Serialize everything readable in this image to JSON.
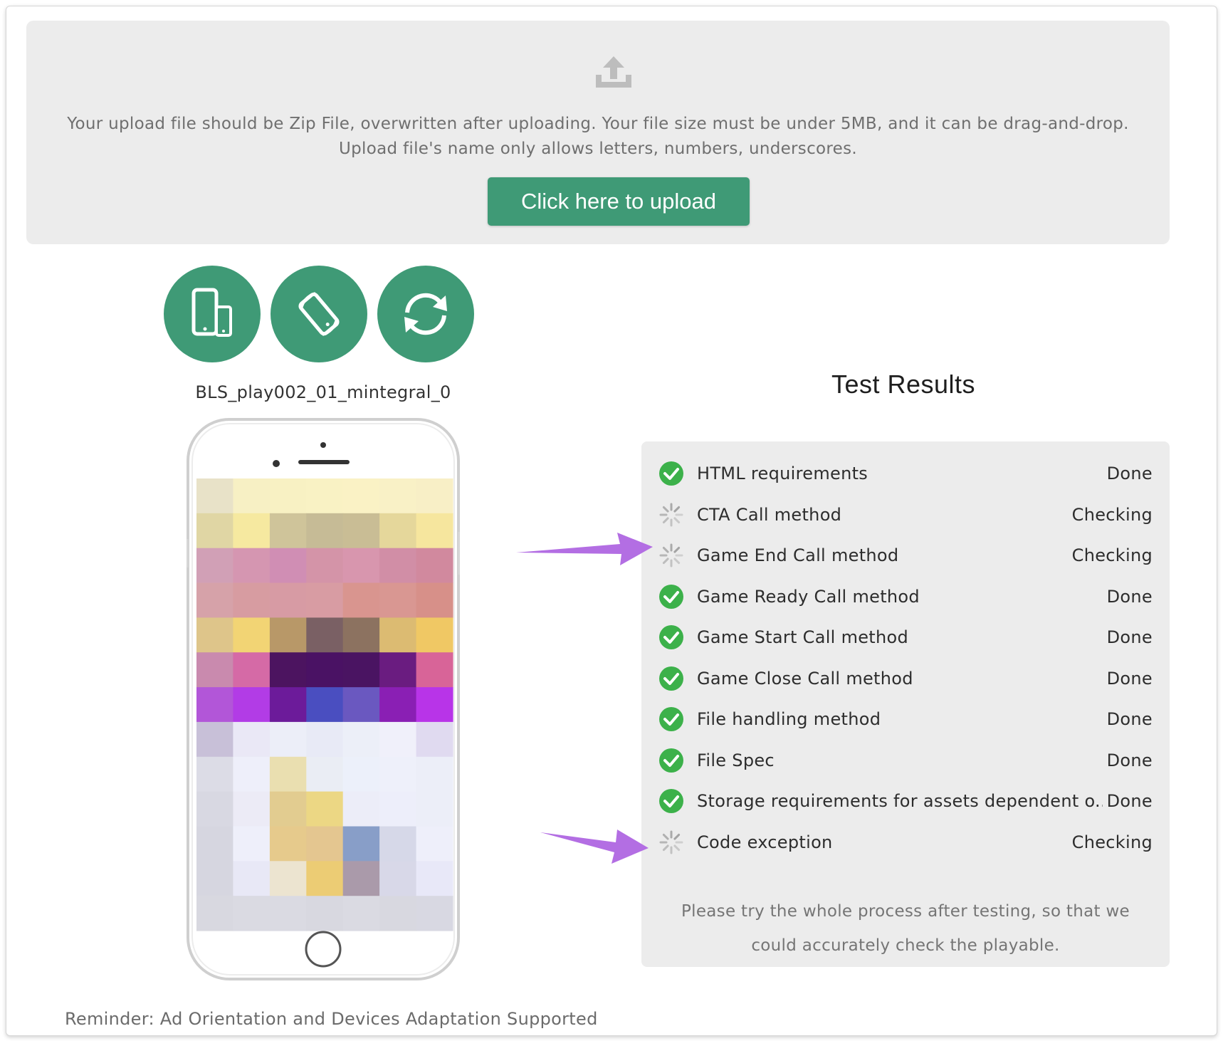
{
  "upload": {
    "icon": "upload-icon",
    "instructions": "Your upload file should be Zip File, overwritten after uploading. Your file size must be under 5MB, and it can be drag-and-drop. Upload file's name only allows letters, numbers, underscores.",
    "button_label": "Click here to upload"
  },
  "device_controls": [
    {
      "icon": "devices-icon"
    },
    {
      "icon": "rotate-device-icon"
    },
    {
      "icon": "refresh-icon"
    }
  ],
  "preview": {
    "file_name": "BLS_play002_01_mintegral_0"
  },
  "reminder": "Reminder: Ad Orientation and Devices Adaptation Supported",
  "results": {
    "title": "Test Results",
    "items": [
      {
        "label": "HTML requirements",
        "status": "Done",
        "state": "done"
      },
      {
        "label": "CTA Call method",
        "status": "Checking",
        "state": "checking"
      },
      {
        "label": "Game End Call method",
        "status": "Checking",
        "state": "checking"
      },
      {
        "label": "Game Ready Call method",
        "status": "Done",
        "state": "done"
      },
      {
        "label": "Game Start Call method",
        "status": "Done",
        "state": "done"
      },
      {
        "label": "Game Close Call method",
        "status": "Done",
        "state": "done"
      },
      {
        "label": "File handling method",
        "status": "Done",
        "state": "done"
      },
      {
        "label": "File Spec",
        "status": "Done",
        "state": "done"
      },
      {
        "label": "Storage requirements for assets dependent o...",
        "status": "Done",
        "state": "done"
      },
      {
        "label": "Code exception",
        "status": "Checking",
        "state": "checking"
      }
    ],
    "note": "Please try the whole process after testing, so that we could accurately check the playable."
  },
  "colors": {
    "accent": "#3f9a76",
    "done": "#3cb14a",
    "checking": "#9a9a9a",
    "arrow": "#b06de0"
  }
}
